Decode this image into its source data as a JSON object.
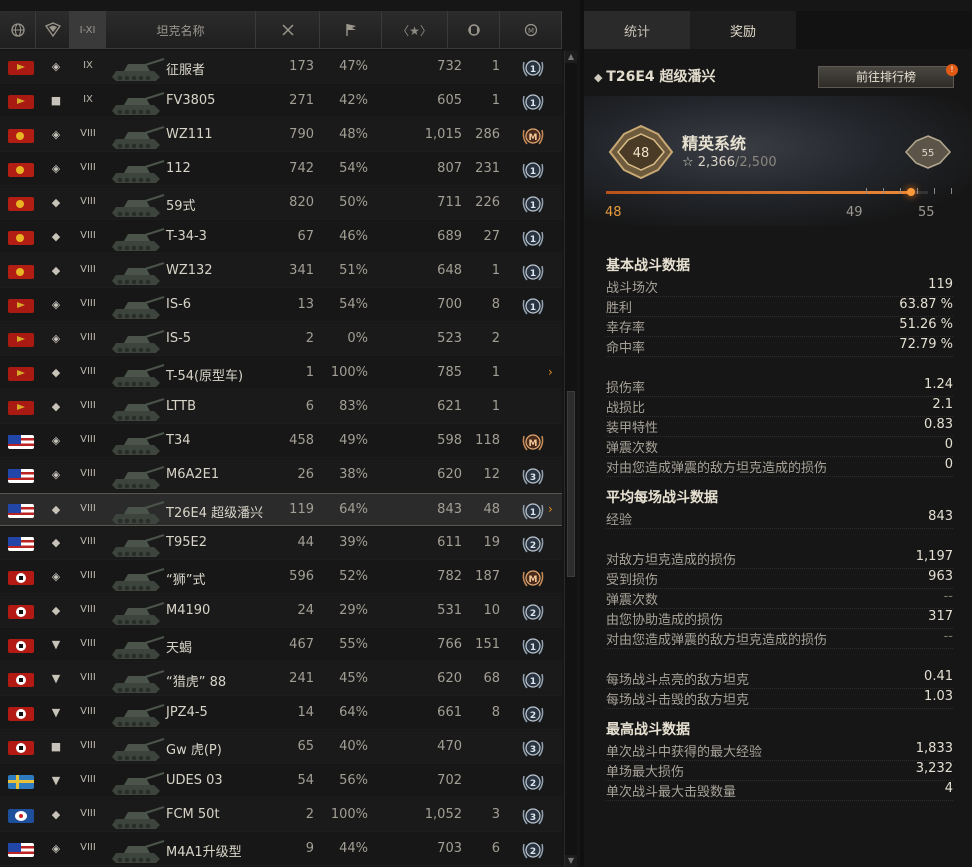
{
  "header": {
    "col_globe_icon": "globe-icon",
    "col_class_icon": "vehicle-class-icon",
    "tier_filter_label": "I-XI",
    "name_label": "坦克名称",
    "col_battles_icon": "crossed-swords-icon",
    "col_wins_icon": "flag-icon",
    "col_exp_label": "〈★〉",
    "col_damage_icon": "shield-swap-icon",
    "col_mastery_icon": "mastery-icon"
  },
  "tanks": [
    {
      "nation": "su",
      "cls": "◈",
      "tier": "IX",
      "name": "征服者",
      "battles": "173",
      "wins": "47%",
      "exp": "732",
      "extra": "1",
      "mastery": "1",
      "selected": false,
      "arrow": ""
    },
    {
      "nation": "su",
      "cls": "■",
      "tier": "IX",
      "name": "FV3805",
      "battles": "271",
      "wins": "42%",
      "exp": "605",
      "extra": "1",
      "mastery": "1",
      "selected": false,
      "arrow": ""
    },
    {
      "nation": "cn",
      "cls": "◈",
      "tier": "VIII",
      "name": "WZ111",
      "battles": "790",
      "wins": "48%",
      "exp": "1,015",
      "extra": "286",
      "mastery": "M",
      "selected": false,
      "arrow": ""
    },
    {
      "nation": "cn",
      "cls": "◈",
      "tier": "VIII",
      "name": "112",
      "battles": "742",
      "wins": "54%",
      "exp": "807",
      "extra": "231",
      "mastery": "1",
      "selected": false,
      "arrow": ""
    },
    {
      "nation": "cn",
      "cls": "◆",
      "tier": "VIII",
      "name": "59式",
      "battles": "820",
      "wins": "50%",
      "exp": "711",
      "extra": "226",
      "mastery": "1",
      "selected": false,
      "arrow": ""
    },
    {
      "nation": "cn",
      "cls": "◆",
      "tier": "VIII",
      "name": "T-34-3",
      "battles": "67",
      "wins": "46%",
      "exp": "689",
      "extra": "27",
      "mastery": "1",
      "selected": false,
      "arrow": ""
    },
    {
      "nation": "cn",
      "cls": "◆",
      "tier": "VIII",
      "name": "WZ132",
      "battles": "341",
      "wins": "51%",
      "exp": "648",
      "extra": "1",
      "mastery": "1",
      "selected": false,
      "arrow": ""
    },
    {
      "nation": "su",
      "cls": "◈",
      "tier": "VIII",
      "name": "IS-6",
      "battles": "13",
      "wins": "54%",
      "exp": "700",
      "extra": "8",
      "mastery": "1",
      "selected": false,
      "arrow": ""
    },
    {
      "nation": "su",
      "cls": "◈",
      "tier": "VIII",
      "name": "IS-5",
      "battles": "2",
      "wins": "0%",
      "exp": "523",
      "extra": "2",
      "mastery": "",
      "selected": false,
      "arrow": ""
    },
    {
      "nation": "su",
      "cls": "◆",
      "tier": "VIII",
      "name": "T-54(原型车)",
      "battles": "1",
      "wins": "100%",
      "exp": "785",
      "extra": "1",
      "mastery": "",
      "selected": false,
      "arrow": "›"
    },
    {
      "nation": "su",
      "cls": "◆",
      "tier": "VIII",
      "name": "LTTB",
      "battles": "6",
      "wins": "83%",
      "exp": "621",
      "extra": "1",
      "mastery": "",
      "selected": false,
      "arrow": ""
    },
    {
      "nation": "us",
      "cls": "◈",
      "tier": "VIII",
      "name": "T34",
      "battles": "458",
      "wins": "49%",
      "exp": "598",
      "extra": "118",
      "mastery": "M",
      "selected": false,
      "arrow": ""
    },
    {
      "nation": "us",
      "cls": "◈",
      "tier": "VIII",
      "name": "M6A2E1",
      "battles": "26",
      "wins": "38%",
      "exp": "620",
      "extra": "12",
      "mastery": "3",
      "selected": false,
      "arrow": ""
    },
    {
      "nation": "us",
      "cls": "◆",
      "tier": "VIII",
      "name": "T26E4 超级潘兴",
      "battles": "119",
      "wins": "64%",
      "exp": "843",
      "extra": "48",
      "mastery": "1",
      "selected": true,
      "arrow": "›"
    },
    {
      "nation": "us",
      "cls": "◆",
      "tier": "VIII",
      "name": "T95E2",
      "battles": "44",
      "wins": "39%",
      "exp": "611",
      "extra": "19",
      "mastery": "2",
      "selected": false,
      "arrow": ""
    },
    {
      "nation": "de",
      "cls": "◈",
      "tier": "VIII",
      "name": "“狮”式",
      "battles": "596",
      "wins": "52%",
      "exp": "782",
      "extra": "187",
      "mastery": "M",
      "selected": false,
      "arrow": ""
    },
    {
      "nation": "de",
      "cls": "◆",
      "tier": "VIII",
      "name": "M4190",
      "battles": "24",
      "wins": "29%",
      "exp": "531",
      "extra": "10",
      "mastery": "2",
      "selected": false,
      "arrow": ""
    },
    {
      "nation": "de",
      "cls": "▼",
      "tier": "VIII",
      "name": "天蝎",
      "battles": "467",
      "wins": "55%",
      "exp": "766",
      "extra": "151",
      "mastery": "1",
      "selected": false,
      "arrow": ""
    },
    {
      "nation": "de",
      "cls": "▼",
      "tier": "VIII",
      "name": "“猎虎” 88",
      "battles": "241",
      "wins": "45%",
      "exp": "620",
      "extra": "68",
      "mastery": "1",
      "selected": false,
      "arrow": ""
    },
    {
      "nation": "de",
      "cls": "▼",
      "tier": "VIII",
      "name": "JPZ4-5",
      "battles": "14",
      "wins": "64%",
      "exp": "661",
      "extra": "8",
      "mastery": "2",
      "selected": false,
      "arrow": ""
    },
    {
      "nation": "de",
      "cls": "■",
      "tier": "VIII",
      "name": "Gw 虎(P)",
      "battles": "65",
      "wins": "40%",
      "exp": "470",
      "extra": "",
      "mastery": "3",
      "selected": false,
      "arrow": ""
    },
    {
      "nation": "se",
      "cls": "▼",
      "tier": "VIII",
      "name": "UDES 03",
      "battles": "54",
      "wins": "56%",
      "exp": "702",
      "extra": "",
      "mastery": "2",
      "selected": false,
      "arrow": ""
    },
    {
      "nation": "fr",
      "cls": "◆",
      "tier": "VIII",
      "name": "FCM 50t",
      "battles": "2",
      "wins": "100%",
      "exp": "1,052",
      "extra": "3",
      "mastery": "3",
      "selected": false,
      "arrow": ""
    },
    {
      "nation": "us",
      "cls": "◈",
      "tier": "VIII",
      "name": "M4A1升级型",
      "battles": "9",
      "wins": "44%",
      "exp": "703",
      "extra": "6",
      "mastery": "2",
      "selected": false,
      "arrow": ""
    }
  ],
  "scroll": {
    "up": "▲",
    "down": "▼"
  },
  "right": {
    "tabs": {
      "stats": "统计",
      "rewards": "奖励"
    },
    "tank_title": "T26E4 超级潘兴",
    "rank_button": "前往排行榜",
    "rank_badge": "!",
    "elite": {
      "title": "精英系统",
      "current_level": "48",
      "next_level": "55",
      "points": "☆ 2,366",
      "max": "/2,500",
      "progress": 0.946,
      "lvl_left": "48",
      "lvl_mid": "49",
      "lvl_right": "55"
    },
    "sections": {
      "basic": "基本战斗数据",
      "avg": "平均每场战斗数据",
      "best": "最高战斗数据"
    },
    "basic": [
      {
        "label": "战斗场次",
        "value": "119"
      },
      {
        "label": "胜利",
        "value": "63.87 %"
      },
      {
        "label": "幸存率",
        "value": "51.26 %"
      },
      {
        "label": "命中率",
        "value": "72.79 %"
      }
    ],
    "basic2": [
      {
        "label": "损伤率",
        "value": "1.24"
      },
      {
        "label": "战损比",
        "value": "2.1"
      },
      {
        "label": "装甲特性",
        "value": "0.83"
      },
      {
        "label": "弹震次数",
        "value": "0"
      },
      {
        "label": "对由您造成弹震的敌方坦克造成的损伤",
        "value": "0"
      }
    ],
    "avg": [
      {
        "label": "经验",
        "value": "843"
      }
    ],
    "avg2": [
      {
        "label": "对敌方坦克造成的损伤",
        "value": "1,197"
      },
      {
        "label": "受到损伤",
        "value": "963"
      },
      {
        "label": "弹震次数",
        "value": "--"
      },
      {
        "label": "由您协助造成的损伤",
        "value": "317"
      },
      {
        "label": "对由您造成弹震的敌方坦克造成的损伤",
        "value": "--"
      }
    ],
    "avg3": [
      {
        "label": "每场战斗点亮的敌方坦克",
        "value": "0.41"
      },
      {
        "label": "每场战斗击毁的敌方坦克",
        "value": "1.03"
      }
    ],
    "best": [
      {
        "label": "单次战斗中获得的最大经验",
        "value": "1,833"
      },
      {
        "label": "单场最大损伤",
        "value": "3,232"
      },
      {
        "label": "单次战斗最大击毁数量",
        "value": "4"
      }
    ]
  }
}
